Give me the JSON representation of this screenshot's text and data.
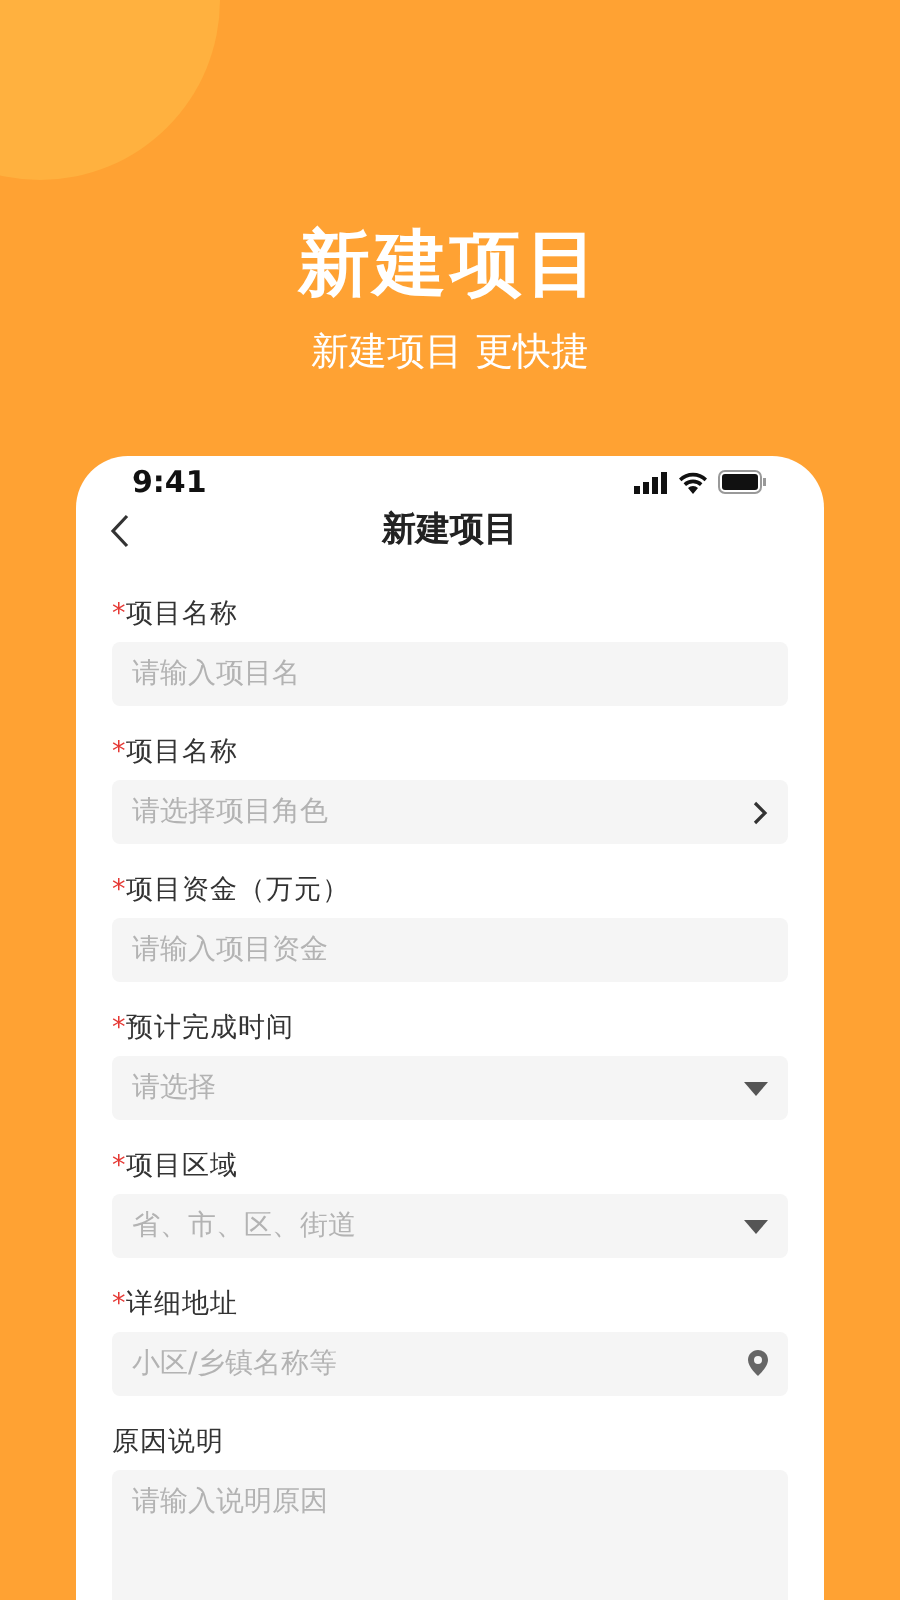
{
  "headline": "新建项目",
  "tagline": "新建项目 更快捷",
  "phone": {
    "status_time": "9:41",
    "nav_title": "新建项目"
  },
  "fields": [
    {
      "required_mark": "*",
      "label": "项目名称",
      "kind": "input",
      "placeholder": "请输入项目名"
    },
    {
      "required_mark": "*",
      "label": "项目名称",
      "kind": "picker",
      "placeholder": "请选择项目角色"
    },
    {
      "required_mark": "*",
      "label": "项目资金（万元）",
      "kind": "input",
      "placeholder": "请输入项目资金"
    },
    {
      "required_mark": "*",
      "label": "预计完成时间",
      "kind": "dropdown",
      "placeholder": "请选择"
    },
    {
      "required_mark": "*",
      "label": "项目区域",
      "kind": "dropdown",
      "placeholder": "省、市、区、街道"
    },
    {
      "required_mark": "*",
      "label": "详细地址",
      "kind": "location",
      "placeholder": "小区/乡镇名称等"
    },
    {
      "label": "原因说明",
      "kind": "textarea",
      "placeholder": "请输入说明原因"
    }
  ]
}
